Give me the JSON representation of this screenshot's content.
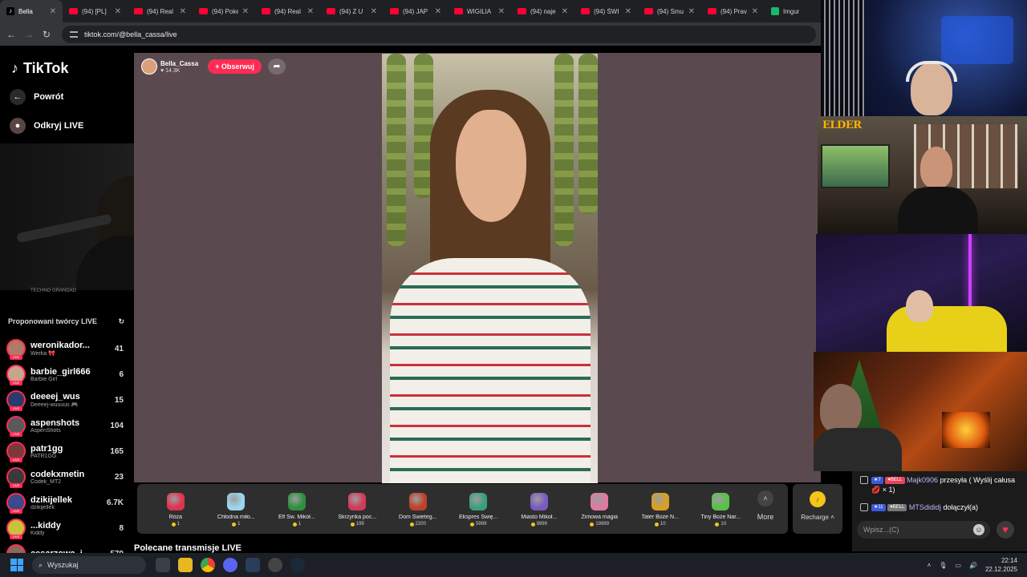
{
  "browser": {
    "tabs": [
      {
        "label": "Bella",
        "kind": "tiktok",
        "active": true
      },
      {
        "label": "(94) [PL]",
        "kind": "youtube"
      },
      {
        "label": "(94) Real",
        "kind": "youtube"
      },
      {
        "label": "(94) Poke",
        "kind": "youtube"
      },
      {
        "label": "(94) Real",
        "kind": "youtube"
      },
      {
        "label": "(94) Z U",
        "kind": "youtube"
      },
      {
        "label": "(94) JAP",
        "kind": "youtube"
      },
      {
        "label": "WIGILIA",
        "kind": "youtube"
      },
      {
        "label": "(94) naje",
        "kind": "youtube"
      },
      {
        "label": "(94) ŚWI",
        "kind": "youtube"
      },
      {
        "label": "(94) Smu",
        "kind": "youtube"
      },
      {
        "label": "(94) Prav",
        "kind": "youtube"
      },
      {
        "label": "Imgur",
        "kind": "imgur"
      }
    ],
    "url": "tiktok.com/@bella_cassa/live"
  },
  "sidebar": {
    "logo_text": "TikTok",
    "back_label": "Powrót",
    "discover_label": "Odkryj LIVE",
    "cam_caption": "TECHNO GRANDAD",
    "suggested_title": "Proponowani twórcy LIVE",
    "creators": [
      {
        "name": "weronikador...",
        "sub": "Werka 🎀",
        "count": "41",
        "color": "#b07a68"
      },
      {
        "name": "barbie_girl666",
        "sub": "Barbie Girl",
        "count": "6",
        "color": "#c9a48c"
      },
      {
        "name": "deeeej_wus",
        "sub": "Deeeej-wuuuus 🎮",
        "count": "15",
        "color": "#2a3b6b"
      },
      {
        "name": "aspenshots",
        "sub": "AspenShots",
        "count": "104",
        "color": "#5a5a5a"
      },
      {
        "name": "patr1gg",
        "sub": "PATR1GG",
        "count": "165",
        "color": "#7a3a3a"
      },
      {
        "name": "codekxmetin",
        "sub": "Codek_MT2",
        "count": "23",
        "color": "#3a3a3a"
      },
      {
        "name": "dzikijellek",
        "sub": "dzikijellek",
        "count": "6.7K",
        "color": "#3a4a8a"
      },
      {
        "name": "...kiddy",
        "sub": "Kiddy",
        "count": "8",
        "color": "#c9c23a"
      },
      {
        "name": "cesarzowa_i...",
        "sub": "",
        "count": "579",
        "color": "#8a6a5a"
      }
    ]
  },
  "live": {
    "host_name": "Bella_Cassa",
    "host_likes": "14.3K",
    "follow_label": "+ Obserwuj"
  },
  "gifts": [
    {
      "name": "Róża",
      "price": "1",
      "color": "#e0334f"
    },
    {
      "name": "Chłodna miło...",
      "price": "1",
      "color": "#9ad6ef"
    },
    {
      "name": "Elf Św. Mikoł...",
      "price": "1",
      "color": "#2f8f3f"
    },
    {
      "name": "Skrzynka poc...",
      "price": "199",
      "color": "#d23a5a"
    },
    {
      "name": "Dom Świeteg...",
      "price": "2200",
      "color": "#c0402a"
    },
    {
      "name": "Ekspres Świę...",
      "price": "5999",
      "color": "#3aa07a"
    },
    {
      "name": "Miasto Mikoł...",
      "price": "9999",
      "color": "#7a5ac0"
    },
    {
      "name": "Zimowa magia",
      "price": "19999",
      "color": "#e07aa0"
    },
    {
      "name": "Tater Boże N...",
      "price": "10",
      "color": "#d8a020"
    },
    {
      "name": "Tiny Boże Nar...",
      "price": "10",
      "color": "#5ac04a"
    }
  ],
  "gift_more_label": "More",
  "recharge_label": "Recharge",
  "recommended_title": "Polecane transmisje LIVE",
  "chat": {
    "messages": [
      {
        "level": "7",
        "fan": "BELL",
        "user": "Majk0906",
        "text": "przesyła ( Wyślij całusa 💋 × 1)"
      },
      {
        "level": "11",
        "fan": "BELL",
        "user": "MTSdididj",
        "text": "dołączył(a)"
      }
    ],
    "input_placeholder": "Wpisz...(C)"
  },
  "overlay": {
    "stream_brand": "ELDER"
  },
  "taskbar": {
    "search_label": "Wyszukaj",
    "time": "22:14",
    "date": "22.12.2025"
  }
}
